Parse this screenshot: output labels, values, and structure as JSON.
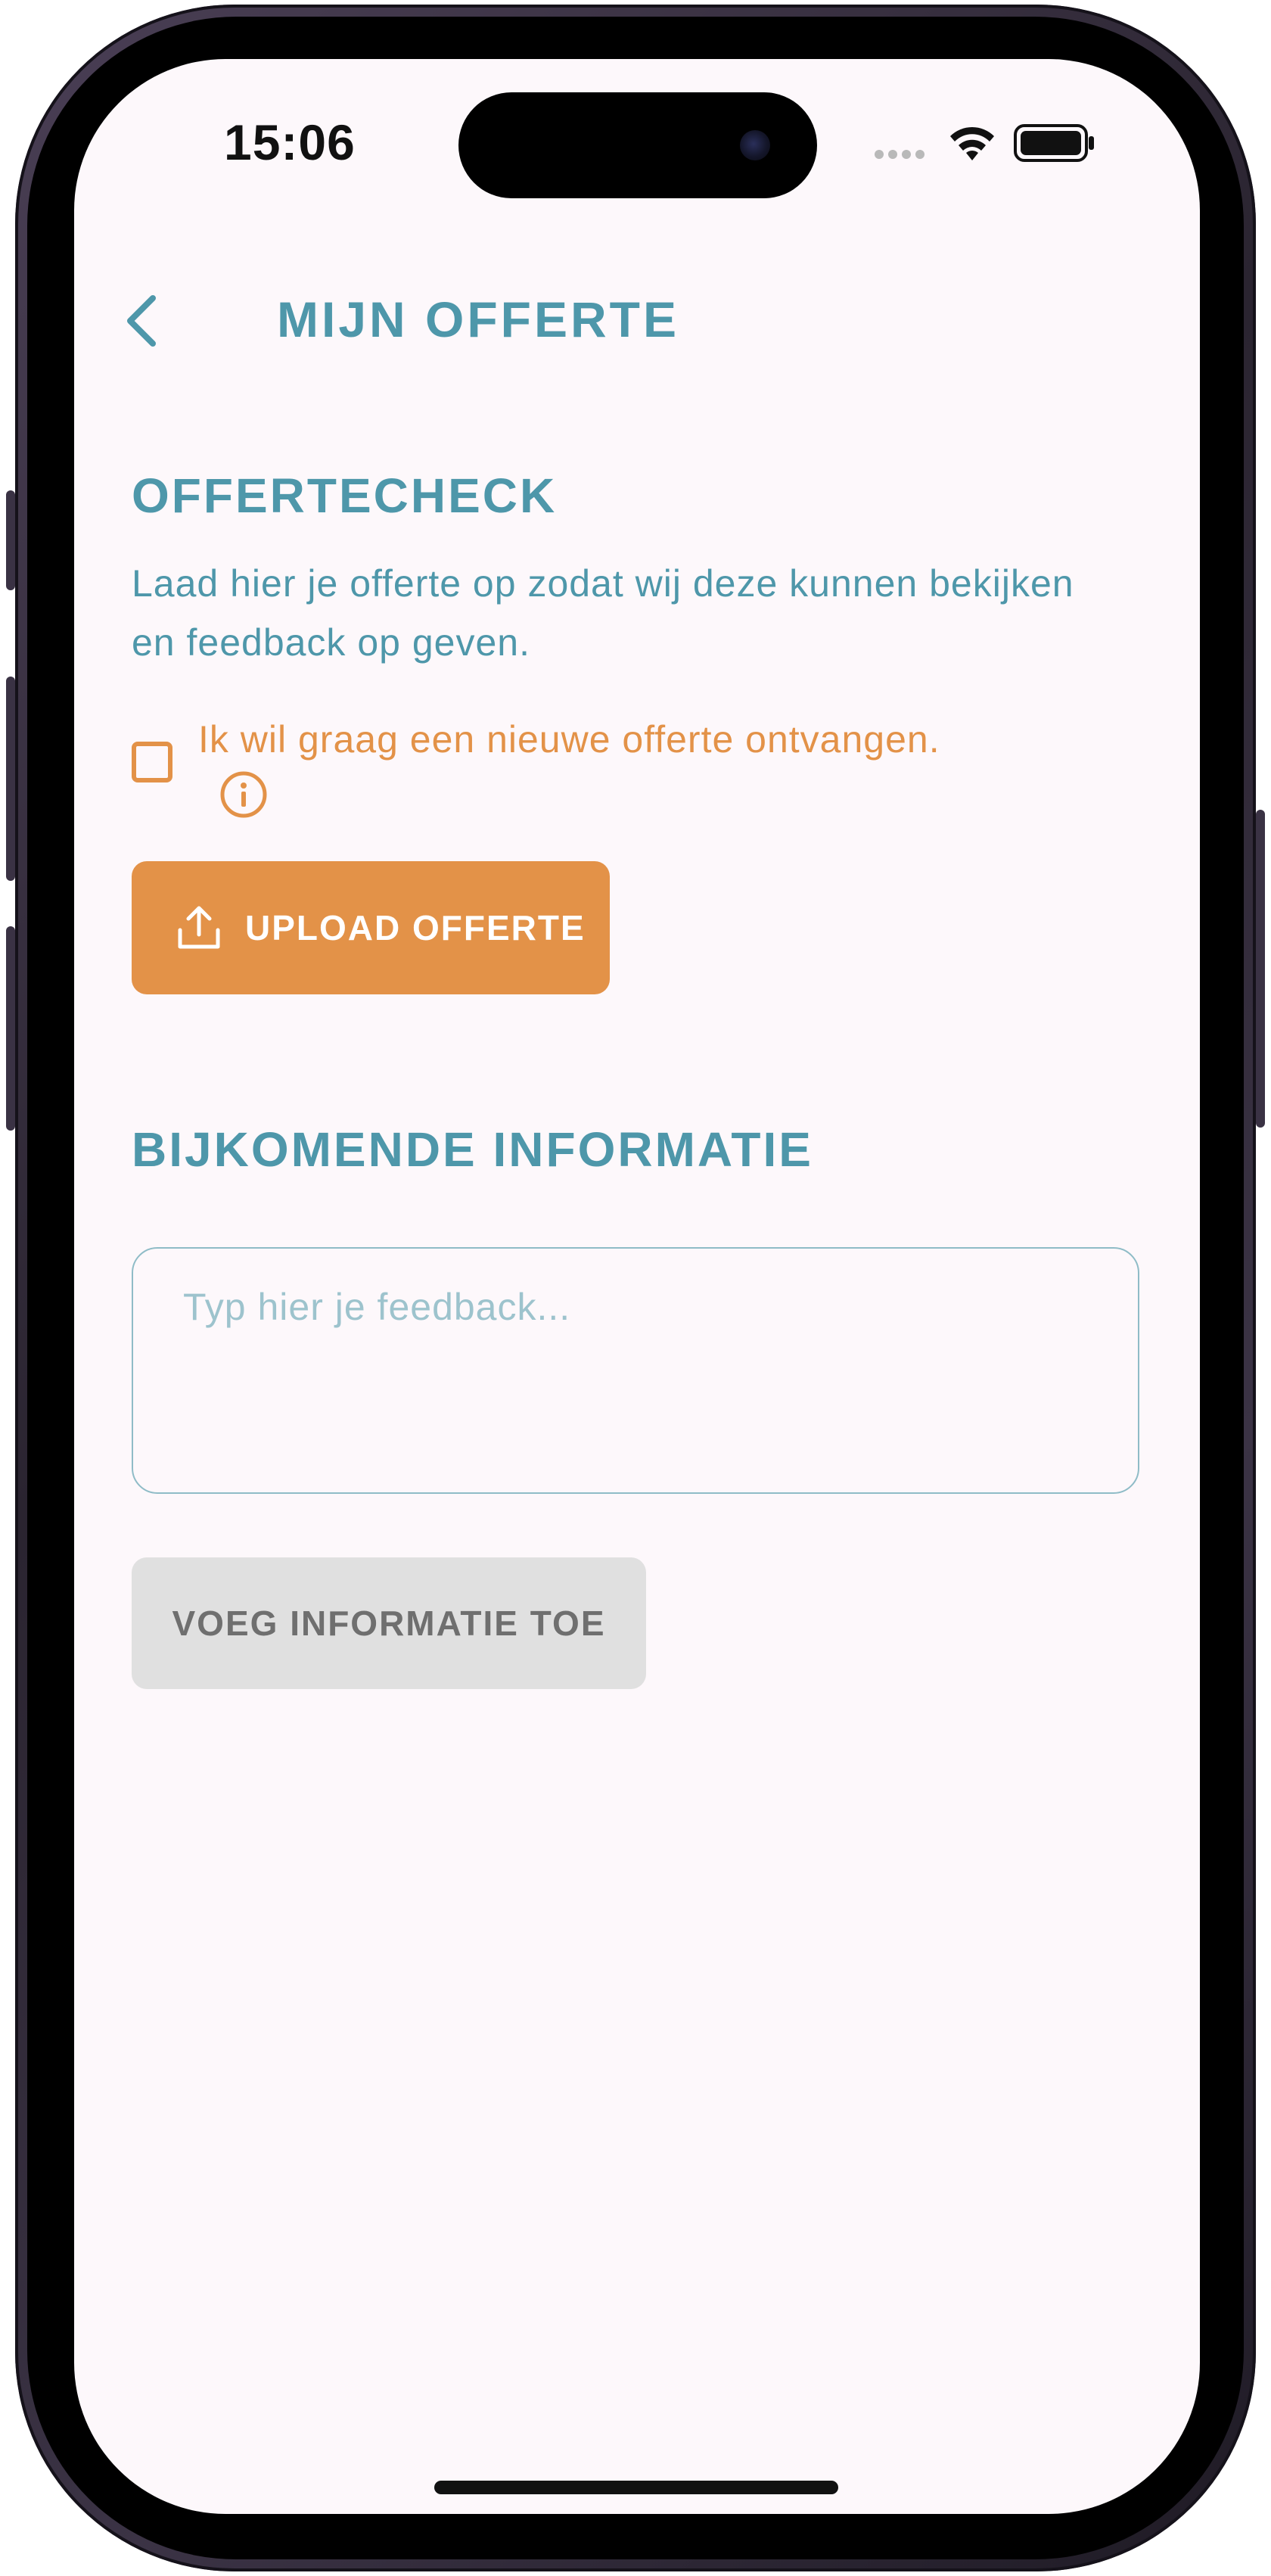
{
  "status_bar": {
    "time": "15:06"
  },
  "header": {
    "back_icon": "chevron-left-icon",
    "title": "MIJN OFFERTE"
  },
  "offertecheck": {
    "title": "OFFERTECHECK",
    "description": "Laad hier je offerte op zodat wij deze kunnen bekijken en feedback op geven.",
    "checkbox_label": "Ik wil graag een nieuwe offerte ontvangen.",
    "checkbox_checked": false,
    "info_icon": "info-circle-icon",
    "upload_button_label": "UPLOAD OFFERTE",
    "upload_icon": "upload-icon"
  },
  "bijkomende": {
    "title": "BIJKOMENDE INFORMATIE",
    "feedback_value": "",
    "feedback_placeholder": "Typ hier je feedback...",
    "add_button_label": "VOEG INFORMATIE TOE"
  },
  "colors": {
    "primary": "#4e97aa",
    "accent": "#e39248",
    "background": "#fdf8fb",
    "disabled": "#e0e0e0"
  }
}
